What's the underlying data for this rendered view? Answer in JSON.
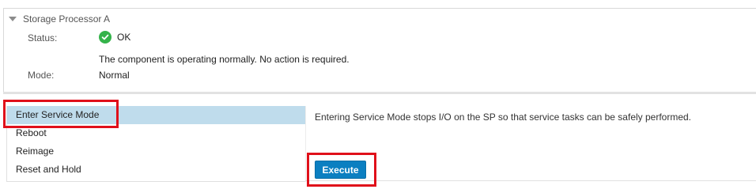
{
  "section": {
    "title": "Storage Processor A"
  },
  "fields": {
    "status_label": "Status:",
    "status_value": "OK",
    "status_icon": "check-circle-icon",
    "status_color": "#34b34a",
    "status_description": "The component is operating normally. No action is required.",
    "mode_label": "Mode:",
    "mode_value": "Normal"
  },
  "actions": {
    "items": [
      {
        "label": "Enter Service Mode",
        "selected": true
      },
      {
        "label": "Reboot",
        "selected": false
      },
      {
        "label": "Reimage",
        "selected": false
      },
      {
        "label": "Reset and Hold",
        "selected": false
      }
    ],
    "selected_color": "#bfdcec"
  },
  "details": {
    "help_text": "Entering Service Mode stops I/O on the SP so that service tasks can be safely performed.",
    "execute_label": "Execute",
    "execute_color": "#0b7fc1"
  },
  "highlight_color": "#e0101a"
}
